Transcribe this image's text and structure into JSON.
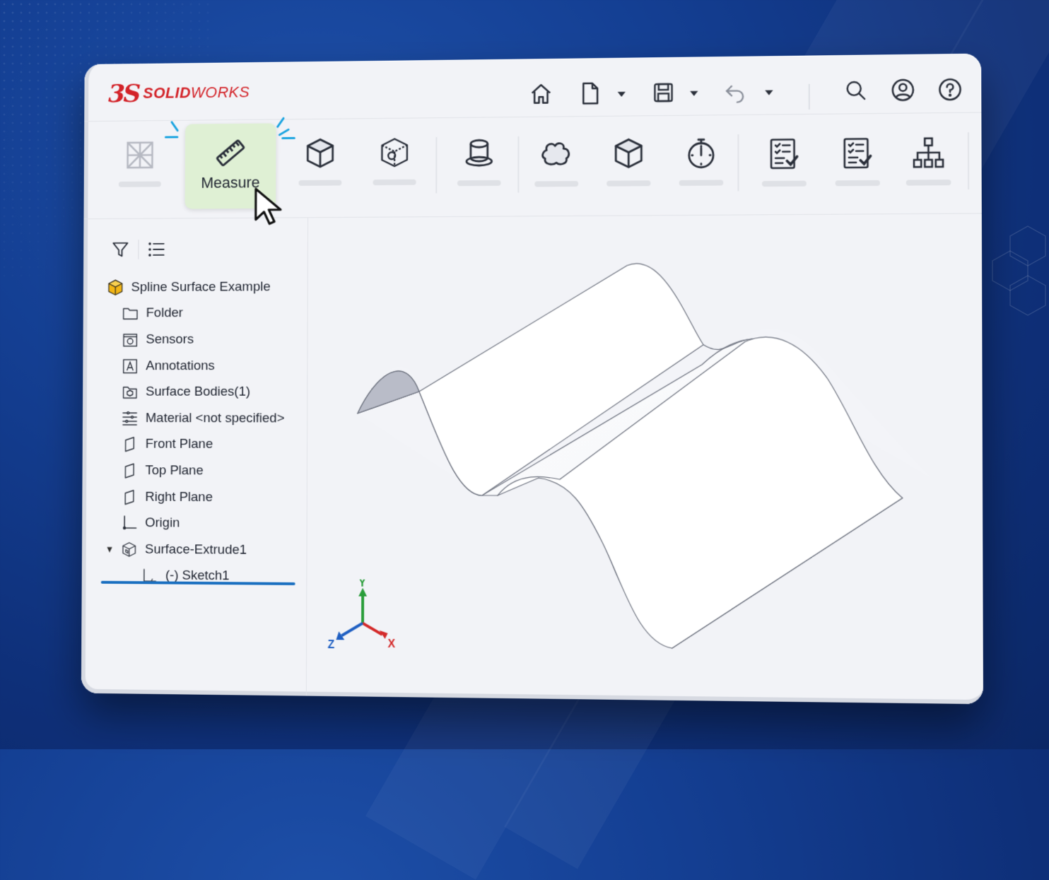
{
  "app": {
    "logo_mark": "3S",
    "logo_text_bold": "SOLID",
    "logo_text_light": "WORKS"
  },
  "header": {
    "icons": [
      "home-icon",
      "new-document-icon",
      "save-icon",
      "undo-icon",
      "search-icon",
      "user-account-icon",
      "help-icon"
    ]
  },
  "ribbon": {
    "highlighted_tool": {
      "label": "Measure",
      "icon": "ruler-icon"
    },
    "tools": [
      "sketch-grid-icon",
      "measure-icon",
      "cube-icon",
      "wireframe-cube-icon",
      "cylinder-icon",
      "cloud-surface-icon",
      "box-icon",
      "stopwatch-icon",
      "checklist-icon",
      "checklist-icon",
      "hierarchy-icon"
    ]
  },
  "tree": {
    "root": "Spline Surface Example",
    "items": [
      {
        "label": "Folder",
        "icon": "folder-icon"
      },
      {
        "label": "Sensors",
        "icon": "sensor-icon"
      },
      {
        "label": "Annotations",
        "icon": "annotation-icon"
      },
      {
        "label": "Surface Bodies(1)",
        "icon": "surface-bodies-icon"
      },
      {
        "label": "Material <not specified>",
        "icon": "material-icon"
      },
      {
        "label": "Front Plane",
        "icon": "plane-icon"
      },
      {
        "label": "Top Plane",
        "icon": "plane-icon"
      },
      {
        "label": "Right Plane",
        "icon": "plane-icon"
      },
      {
        "label": "Origin",
        "icon": "origin-icon"
      },
      {
        "label": "Surface-Extrude1",
        "icon": "extrude-icon",
        "expanded": true
      },
      {
        "label": "(-) Sketch1",
        "icon": "sketch-icon",
        "child": true
      }
    ]
  },
  "triad": {
    "x": "X",
    "y": "Y",
    "z": "Z"
  },
  "colors": {
    "brand_red": "#d32329",
    "background_blue": "#143f93",
    "highlight_green": "#dff0d4",
    "active_blue": "#1a6fc0",
    "axis_x": "#d42a2a",
    "axis_y": "#2a9d3a",
    "axis_z": "#1f5fc2"
  }
}
